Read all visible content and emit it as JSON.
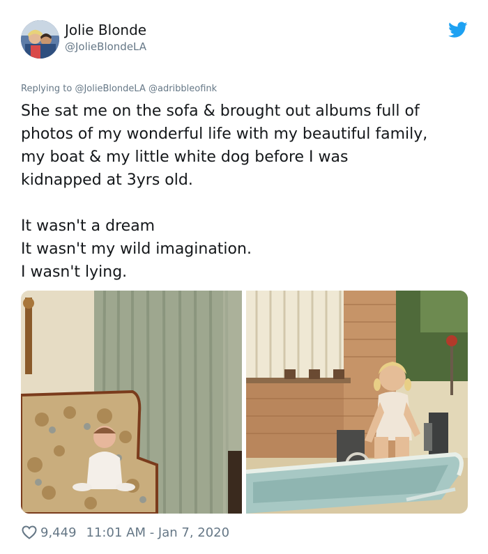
{
  "author": {
    "display_name": "Jolie Blonde",
    "handle": "@JolieBlondeLA"
  },
  "reply": {
    "prefix": "Replying to",
    "mentions": "@JolieBlondeLA @adribbleofink"
  },
  "tweet": {
    "paragraph1": [
      "She sat me on the sofa & brought out albums full of",
      "photos of my wonderful life with my beautiful family,",
      "my boat & my little white dog before I was",
      "kidnapped at 3yrs old."
    ],
    "paragraph2": [
      "It wasn't a dream",
      "It wasn't my wild imagination.",
      "I wasn't lying."
    ]
  },
  "media": {
    "photos": [
      "toddler-in-armchair",
      "toddler-on-boat"
    ]
  },
  "footer": {
    "likes": "9,449",
    "timestamp": "11:01 AM - Jan 7, 2020"
  },
  "colors": {
    "text": "#14171a",
    "muted": "#657786",
    "twitter_blue": "#1da1f2"
  },
  "icons": [
    "twitter-bird-icon",
    "heart-icon"
  ]
}
